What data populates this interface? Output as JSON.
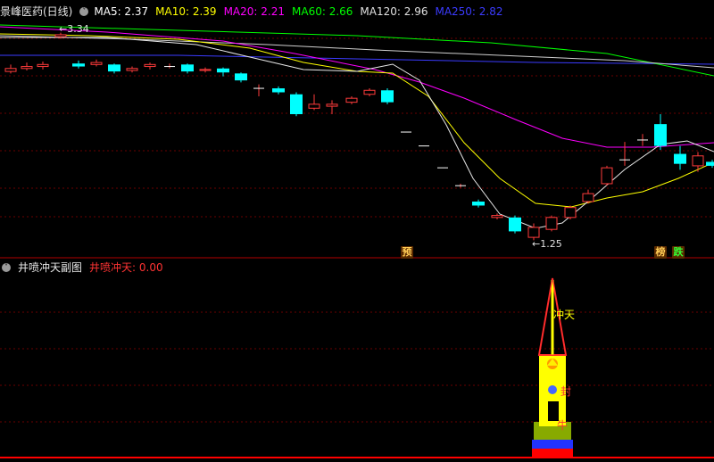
{
  "main_panel": {
    "title": "景峰医药(日线)",
    "ma": [
      {
        "label": "MA5: 2.37",
        "color": "#ffffff"
      },
      {
        "label": "MA10: 2.39",
        "color": "#ffff00"
      },
      {
        "label": "MA20: 2.21",
        "color": "#ff00ff"
      },
      {
        "label": "MA60: 2.66",
        "color": "#00ff00"
      },
      {
        "label": "MA120: 2.96",
        "color": "#e0e0e0"
      },
      {
        "label": "MA250: 2.82",
        "color": "#3b3bff"
      }
    ],
    "high_label": "3.34",
    "low_label": "1.25",
    "flags": [
      {
        "text": "预",
        "color": "#ffcc55",
        "bg": "#5a2a00"
      },
      {
        "text": "榜",
        "color": "#ffcc55",
        "bg": "#5a2a00"
      },
      {
        "text": "跌",
        "color": "#33ff33",
        "bg": "#5a2a00"
      }
    ]
  },
  "sub_panel": {
    "title": "井喷冲天副图",
    "indicator": "井喷冲天: 0.00",
    "labels": {
      "top": "冲天",
      "mid": "封",
      "bottom": "牛"
    }
  },
  "colors": {
    "up": "#ff3b3b",
    "down": "#00ffff",
    "grid": "#7a0000"
  }
}
